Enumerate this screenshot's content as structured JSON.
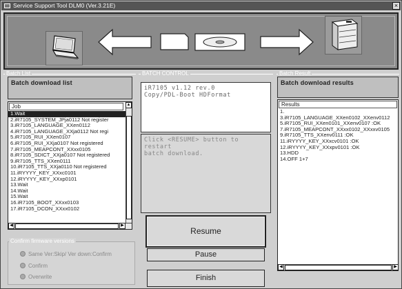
{
  "window": {
    "title": "Service Support Tool DLM0 (Ver.3.21E)",
    "close_glyph": "×"
  },
  "batch_list": {
    "group_label": "Batch List",
    "title": "Batch download list",
    "column_header": "Job",
    "items": [
      "1.Wait",
      "2.iR7105_SYSTEM_JPja0112 Not register",
      "3.iR7105_LANGUAGE_XXen0112",
      "4.iR7105_LANGUAGE_XXja0112 Not regi",
      "5.iR7105_RUI_XXen0107",
      "6.iR7105_RUI_XXja0107 Not registered",
      "7.iR7105_MEAPCONT_XXxx0105",
      "8.iR7105_SDICT_XXja0107 Not registered",
      "9.iR7105_TTS_XXen0111",
      "10.iR7105_TTS_XXja0110 Not registered",
      "11.iRYYYY_KEY_XXxc0101",
      "12.iRYYYY_KEY_XXxp0101",
      "13.Wait",
      "14.Wait",
      "15.Wait",
      "16.iR7105_BOOT_XXxx0103",
      "17.iR7105_DCON_XXxx0102"
    ]
  },
  "batch_control": {
    "group_label": "BATCH CONTROL",
    "info_text": [
      "iR7105 v1.12 rev.0",
      "Copy/PDL-Boot HDFormat"
    ],
    "message_text": [
      "Click <RESUME> button to restart",
      "batch download."
    ],
    "resume_label": "Resume",
    "pause_label": "Pause",
    "finish_label": "Finish"
  },
  "batch_result": {
    "group_label": "Batch Result",
    "title": "Batch download results",
    "column_header": "Results",
    "items": [
      "1.",
      "3.iR7105_LANGUAGE_XXen0102_XXenv0112",
      "5.iR7105_RUI_XXen0101_XXenv0107 :OK",
      "7.iR7105_MEAPCONT_XXxx0102_XXxxv0105",
      "9.iR7105_TTS_XXenv0111 :OK",
      "11.iRYYYY_KEY_XXxcv0101 :OK",
      "12.iRYYYY_KEY_XXxpv0101 :OK",
      "13.HDD",
      "14.OFF 1+7"
    ]
  },
  "confirm_versions": {
    "group_label": "Confirm firmware versions",
    "options": [
      "Same Ver:Skip/ Ver down:Confirm",
      "Confirm",
      "Overwrite"
    ]
  },
  "icons": {
    "laptop": "laptop-icon",
    "printer": "printer-icon",
    "memory_card": "memory-card-icon",
    "disc": "disc-icon"
  }
}
